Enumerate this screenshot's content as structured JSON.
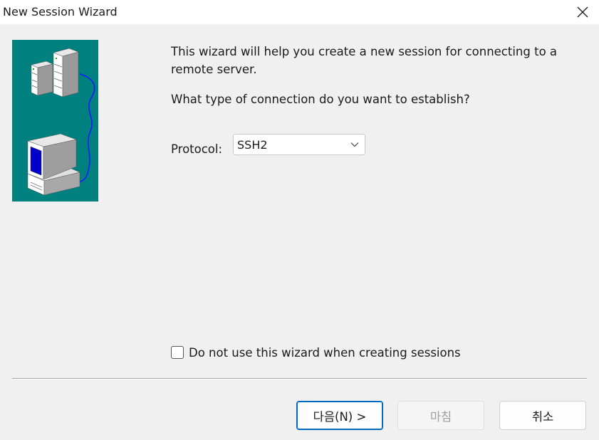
{
  "window": {
    "title": "New Session Wizard"
  },
  "intro_text": "This wizard will help you create a new session for connecting to a remote server.",
  "question_text": "What type of connection do you want to establish?",
  "protocol": {
    "label": "Protocol:",
    "selected": "SSH2"
  },
  "skip_wizard": {
    "label": "Do not use this wizard when creating sessions",
    "checked": false
  },
  "buttons": {
    "next": "다음(N) >",
    "finish": "마침",
    "cancel": "취소"
  },
  "colors": {
    "illustration_bg": "#00807f",
    "accent": "#0067c0"
  },
  "icons": {
    "close": "close-icon",
    "dropdown": "chevron-down-icon",
    "illustration": "computer-server-illustration"
  }
}
